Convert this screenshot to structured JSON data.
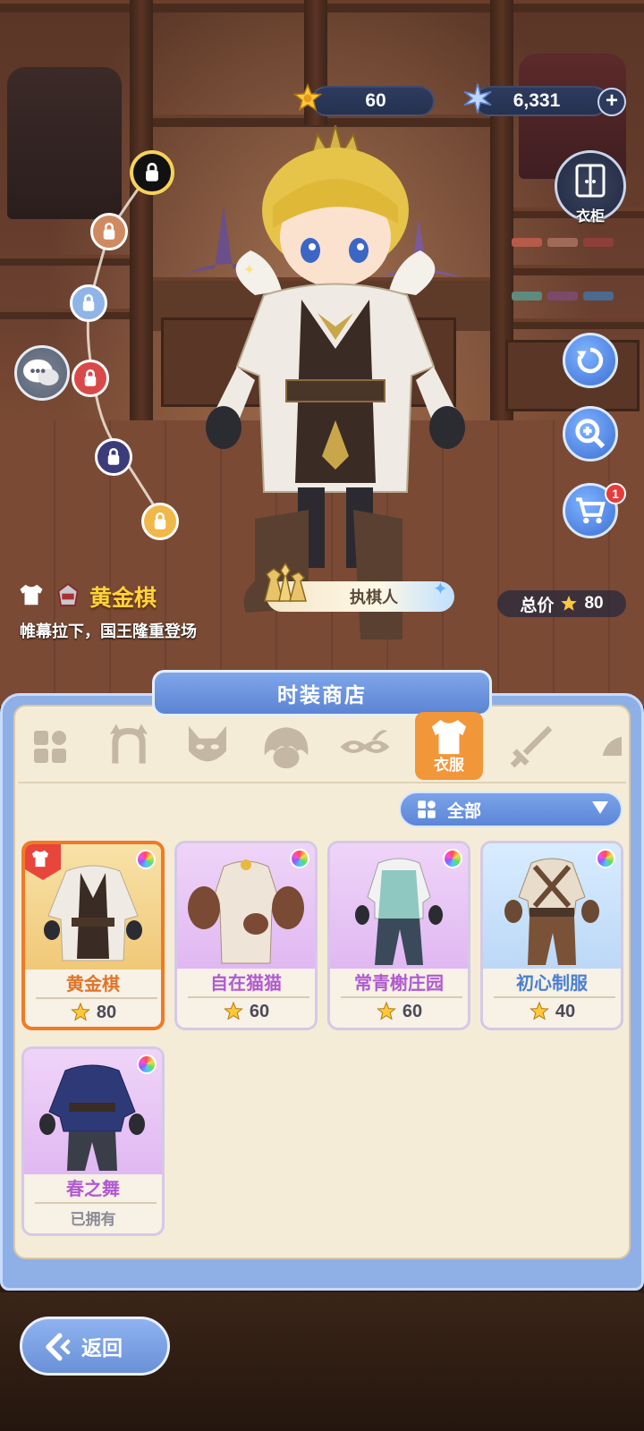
{
  "currency": {
    "coins": "60",
    "gems": "6,331",
    "add_label": "+"
  },
  "side_buttons": {
    "wardrobe_label": "衣柜",
    "cart_badge": "1"
  },
  "outfit": {
    "name": "黄金棋",
    "description": "帷幕拉下，国王隆重登场",
    "title_tag": "执棋人",
    "total_label": "总价",
    "total_value": "80"
  },
  "shop": {
    "title": "时装商店",
    "active_category_label": "衣服",
    "categories": [
      "all-icon",
      "headwear-icon",
      "mask-icon",
      "hair-icon",
      "eyewear-icon",
      "clothes-icon",
      "weapon-icon",
      "more-icon"
    ],
    "filter_label": "全部",
    "items": [
      {
        "name": "黄金棋",
        "price": "80",
        "name_color": "#e07428",
        "bg": "#f7d89a",
        "selected": true
      },
      {
        "name": "自在猫猫",
        "price": "60",
        "name_color": "#b05ad0",
        "bg": "#e9c8f5",
        "selected": false
      },
      {
        "name": "常青榭庄园",
        "price": "60",
        "name_color": "#b05ad0",
        "bg": "#e9c8f5",
        "selected": false
      },
      {
        "name": "初心制服",
        "price": "40",
        "name_color": "#4a7fd0",
        "bg": "#cfe4fb",
        "selected": false
      },
      {
        "name": "春之舞",
        "owned_label": "已拥有",
        "name_color": "#b05ad0",
        "bg": "#e9c8f5",
        "selected": false
      }
    ]
  },
  "back_label": "返回",
  "colors": {
    "panel_blue": "#8fb0e6",
    "panel_cream": "#f5ecd8",
    "accent_orange": "#f2963a",
    "gold": "#ffd23a"
  }
}
